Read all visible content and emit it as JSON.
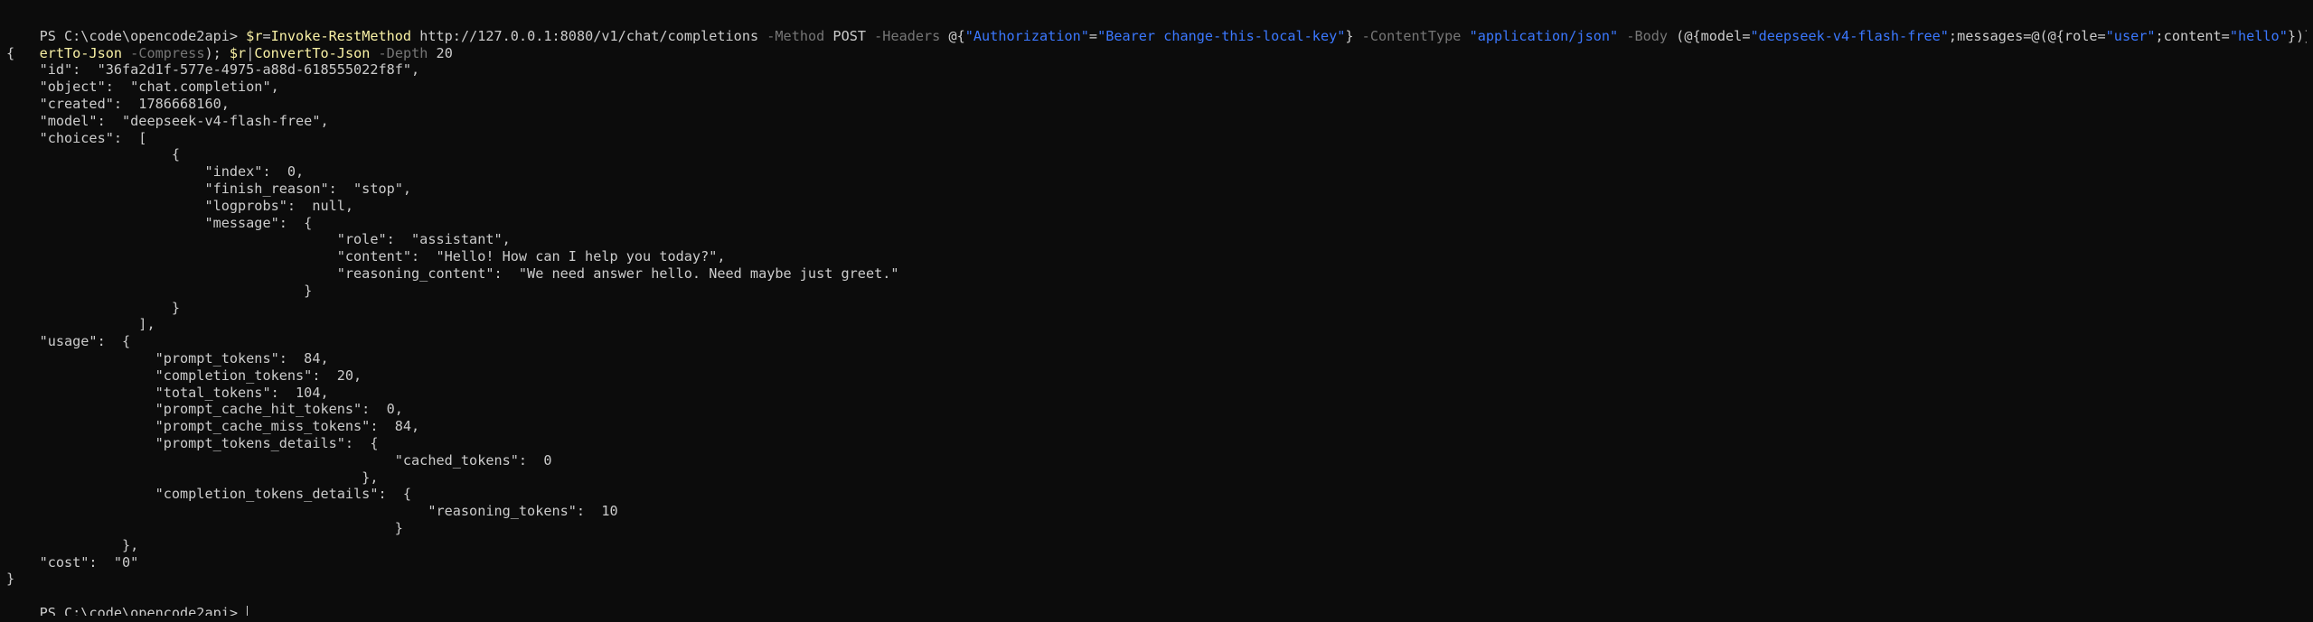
{
  "terminal": {
    "command": {
      "prompt": "PS C:\\code\\opencode2api> ",
      "tokens": [
        {
          "text": "$r",
          "color": "#f9f1a5"
        },
        {
          "text": "=",
          "color": "#cccccc"
        },
        {
          "text": "Invoke-RestMethod",
          "color": "#f9f1a5"
        },
        {
          "text": " http://127.0.0.1:8080/v1/chat/completions ",
          "color": "#cccccc"
        },
        {
          "text": "-Method",
          "color": "#767676"
        },
        {
          "text": " POST ",
          "color": "#cccccc"
        },
        {
          "text": "-Headers",
          "color": "#767676"
        },
        {
          "text": " @{",
          "color": "#cccccc"
        },
        {
          "text": "\"Authorization\"",
          "color": "#3b78ff"
        },
        {
          "text": "=",
          "color": "#cccccc"
        },
        {
          "text": "\"Bearer change-this-local-key\"",
          "color": "#3b78ff"
        },
        {
          "text": "} ",
          "color": "#cccccc"
        },
        {
          "text": "-ContentType",
          "color": "#767676"
        },
        {
          "text": " ",
          "color": "#cccccc"
        },
        {
          "text": "\"application/json\"",
          "color": "#3b78ff"
        },
        {
          "text": " ",
          "color": "#cccccc"
        },
        {
          "text": "-Body",
          "color": "#767676"
        },
        {
          "text": " (@{model=",
          "color": "#cccccc"
        },
        {
          "text": "\"deepseek-v4-flash-free\"",
          "color": "#3b78ff"
        },
        {
          "text": ";messages=@(@{role=",
          "color": "#cccccc"
        },
        {
          "text": "\"user\"",
          "color": "#3b78ff"
        },
        {
          "text": ";content=",
          "color": "#cccccc"
        },
        {
          "text": "\"hello\"",
          "color": "#3b78ff"
        },
        {
          "text": "})}|",
          "color": "#cccccc"
        },
        {
          "text": "Conv",
          "color": "#f9f1a5"
        }
      ],
      "wrap_tokens": [
        {
          "text": "ertTo-Json",
          "color": "#f9f1a5"
        },
        {
          "text": " ",
          "color": "#cccccc"
        },
        {
          "text": "-Compress",
          "color": "#767676"
        },
        {
          "text": "); ",
          "color": "#cccccc"
        },
        {
          "text": "$r",
          "color": "#f9f1a5"
        },
        {
          "text": "|",
          "color": "#cccccc"
        },
        {
          "text": "ConvertTo-Json",
          "color": "#f9f1a5"
        },
        {
          "text": " ",
          "color": "#cccccc"
        },
        {
          "text": "-Depth",
          "color": "#767676"
        },
        {
          "text": " 20",
          "color": "#cccccc"
        }
      ]
    },
    "output_lines": [
      "{",
      "    \"id\":  \"36fa2d1f-577e-4975-a88d-618555022f8f\",",
      "    \"object\":  \"chat.completion\",",
      "    \"created\":  1786668160,",
      "    \"model\":  \"deepseek-v4-flash-free\",",
      "    \"choices\":  [",
      "                    {",
      "                        \"index\":  0,",
      "                        \"finish_reason\":  \"stop\",",
      "                        \"logprobs\":  null,",
      "                        \"message\":  {",
      "                                        \"role\":  \"assistant\",",
      "                                        \"content\":  \"Hello! How can I help you today?\",",
      "                                        \"reasoning_content\":  \"We need answer hello. Need maybe just greet.\"",
      "                                    }",
      "                    }",
      "                ],",
      "    \"usage\":  {",
      "                  \"prompt_tokens\":  84,",
      "                  \"completion_tokens\":  20,",
      "                  \"total_tokens\":  104,",
      "                  \"prompt_cache_hit_tokens\":  0,",
      "                  \"prompt_cache_miss_tokens\":  84,",
      "                  \"prompt_tokens_details\":  {",
      "                                               \"cached_tokens\":  0",
      "                                           },",
      "                  \"completion_tokens_details\":  {",
      "                                                   \"reasoning_tokens\":  10",
      "                                               }",
      "              },",
      "    \"cost\":  \"0\"",
      "}"
    ],
    "final_prompt": "PS C:\\code\\opencode2api> "
  }
}
